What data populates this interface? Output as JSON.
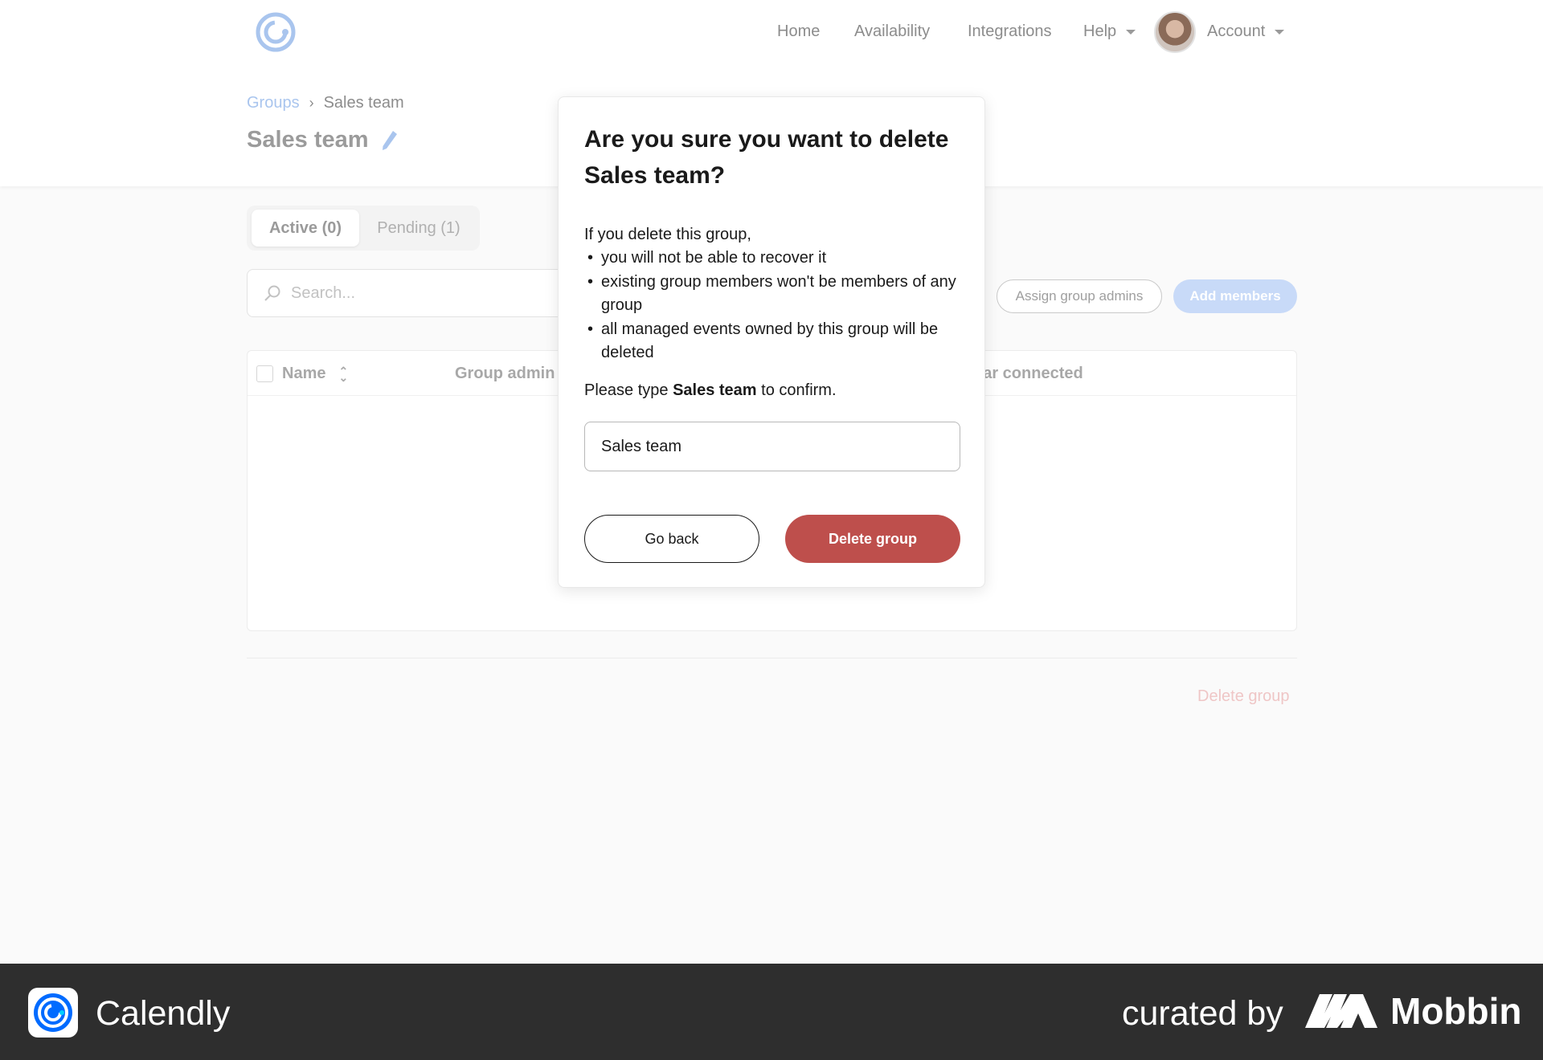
{
  "nav": {
    "home": "Home",
    "availability": "Availability",
    "integrations": "Integrations",
    "help": "Help",
    "account": "Account"
  },
  "breadcrumb": {
    "parent": "Groups",
    "current": "Sales team"
  },
  "page_title": "Sales team",
  "tabs": {
    "active": "Active (0)",
    "pending": "Pending (1)"
  },
  "search": {
    "placeholder": "Search..."
  },
  "actions": {
    "assign_admins": "Assign group admins",
    "add_members": "Add members"
  },
  "table": {
    "headers": [
      "Name",
      "Group admin",
      "dar connected"
    ]
  },
  "footer_delete": "Delete group",
  "modal": {
    "title": "Are you sure you want to delete Sales team?",
    "intro": "If you delete this group,",
    "bullets": [
      "you will not be able to recover it",
      "existing group members won't be members of any group",
      "all managed events owned by this group will be deleted"
    ],
    "confirm_prefix": "Please type",
    "confirm_name": "Sales team",
    "confirm_suffix": "to confirm.",
    "input_value": "Sales team",
    "back_label": "Go back",
    "delete_label": "Delete group"
  },
  "footer": {
    "app_name": "Calendly",
    "curated_by": "curated by",
    "brand": "Mobbin"
  },
  "colors": {
    "brand_blue": "#006bff",
    "danger": "#be4f4c",
    "footer_bg": "#2e2e2e"
  }
}
